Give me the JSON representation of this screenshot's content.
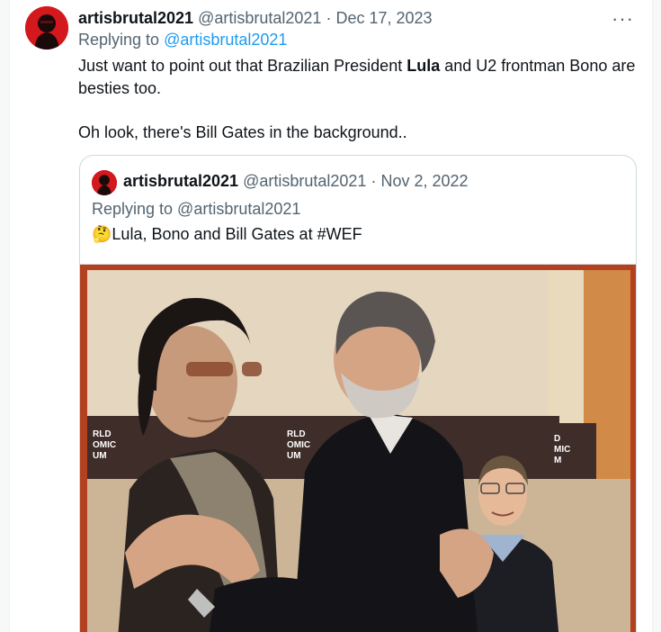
{
  "tweet": {
    "author_name": "artisbrutal2021",
    "handle": "@artisbrutal2021",
    "separator": "·",
    "date": "Dec 17, 2023",
    "more_label": "···",
    "replying_prefix": "Replying to",
    "replying_handle": "@artisbrutal2021",
    "text_part1": "Just want to point out that Brazilian President ",
    "text_bold": "Lula",
    "text_part2": " and U2 frontman Bono are besties too.",
    "text_para2": "Oh look, there's Bill Gates in the background.."
  },
  "quote": {
    "author_name": "artisbrutal2021",
    "handle": "@artisbrutal2021",
    "separator": "·",
    "date": "Nov 2, 2022",
    "replying_text": "Replying to @artisbrutal2021",
    "emoji": "🤔",
    "text": "Lula, Bono and Bill Gates at #WEF"
  },
  "photo": {
    "banner_left": [
      "RLD",
      "OMIC",
      "UM"
    ],
    "banner_mid": [
      "RLD",
      "OMIC",
      "UM"
    ],
    "banner_right": [
      "D",
      "MIC",
      "M"
    ]
  },
  "colors": {
    "link": "#1d9bf0",
    "muted": "#536471",
    "photo_frame": "#b3401f"
  }
}
